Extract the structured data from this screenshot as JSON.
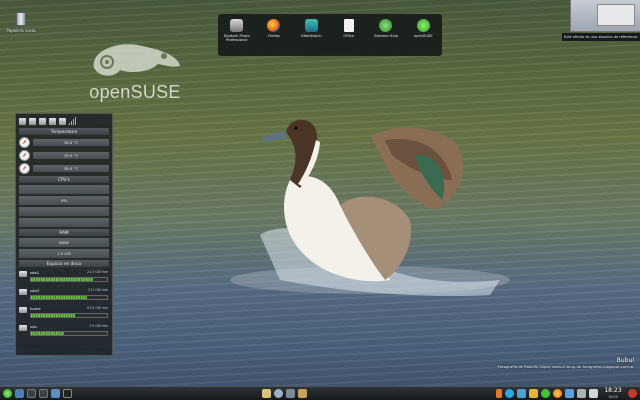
{
  "desktop": {
    "icons": [
      {
        "icon": "trash-icon",
        "label": "Papelera vacía"
      }
    ]
  },
  "logo": {
    "text": "openSUSE"
  },
  "launcher": {
    "items": [
      {
        "label": "Digikam Photo Professional",
        "icon": "photo-app-icon",
        "color": "#c8c8c8"
      },
      {
        "label": "Firefox",
        "icon": "firefox-icon",
        "color": "#e66b1f"
      },
      {
        "label": "KNetAttach",
        "icon": "network-icon",
        "color": "#1f9b8d"
      },
      {
        "label": "Office",
        "icon": "document-icon",
        "color": "#f2f2f2"
      },
      {
        "label": "Sistema Help",
        "icon": "help-icon",
        "color": "#43a43c"
      },
      {
        "label": "openSUSE",
        "icon": "opensuse-icon",
        "color": "#3fba2f"
      }
    ]
  },
  "preview": {
    "caption": "Este efecto es una esquina de referencia"
  },
  "monitor": {
    "toolbar_icons": [
      "monitor-icon",
      "doc-icon",
      "chip-icon",
      "memory-icon",
      "disk-icon",
      "signal-bars-icon"
    ],
    "sections": {
      "temperature": "Temperature",
      "cpu": "CPU's",
      "ram": "RAM",
      "disks": "Espacio en disco"
    },
    "temperatures": [
      "38.0 °C",
      "39.0 °C",
      "38.0 °C"
    ],
    "cpu_values": [
      "",
      "0%",
      "",
      ""
    ],
    "ram_values": [
      "RAM",
      "SWAP",
      "1.9 GiB"
    ],
    "disks": [
      {
        "name": "sda1",
        "size": "24.3 GiB free",
        "used": 0.82
      },
      {
        "name": "sda3",
        "size": "211 GiB free",
        "used": 0.74
      },
      {
        "name": "home",
        "size": "63.8 GiB free",
        "used": 0.58
      },
      {
        "name": "usb",
        "size": "3.9 GiB free",
        "used": 0.44
      }
    ]
  },
  "wallpaper": {
    "title": "Bubul",
    "credit": "Fotografía de Rodolfo López www.el-blog-de-fotografos.blogspot.com.ar"
  },
  "taskbar": {
    "left_icons": [
      "start-menu-icon",
      "activities-icon",
      "pager-icon",
      "pager-icon",
      "file-manager-icon",
      "terminal-icon"
    ],
    "task_icons": [
      "clipboard-icon",
      "search-icon",
      "network-icon",
      "tools-icon"
    ],
    "tray_icons": [
      "notification-icon",
      "skype-icon",
      "chat-icon",
      "folder-icon",
      "opensuse-icon",
      "firefox-icon",
      "download-icon",
      "printer-icon",
      "volume-icon",
      "battery-icon"
    ],
    "clock": {
      "time": "18:23",
      "date": "10/20"
    }
  }
}
